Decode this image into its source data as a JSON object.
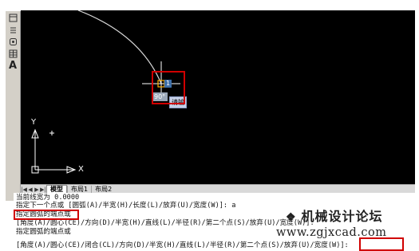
{
  "toolbar": {
    "letter_tool": "A"
  },
  "canvas": {
    "angle_tooltip": "90°",
    "input_value": "1",
    "input_bubble": "请输",
    "axis_y": "Y",
    "axis_x": "X"
  },
  "tabs": {
    "items": [
      "模型",
      "布局1",
      "布局2"
    ],
    "active": "模型"
  },
  "command": {
    "lines": [
      "当前线宽为 0.0000",
      "指定下一个点或 [圆弧(A)/半宽(H)/长度(L)/放弃(U)/宽度(W)]: a",
      "指定圆弧的端点或",
      "[角度(A)/圆心(CE)/方向(D)/半宽(H)/直线(L)/半径(R)/第二个点(S)/放弃(U)/宽度(W)]:",
      "指定圆弧的端点或",
      "[角度(A)/圆心(CE)/闭合(CL)/方向(D)/半宽(H)/直线(L)/半径(R)/第二个点(S)/放弃(U)/宽度(W)]:"
    ]
  },
  "watermark": {
    "brand": "机械设计论坛",
    "url": "www.zgjxcad.com"
  },
  "colors": {
    "highlight": "#d00000",
    "canvas_bg": "#000000"
  }
}
